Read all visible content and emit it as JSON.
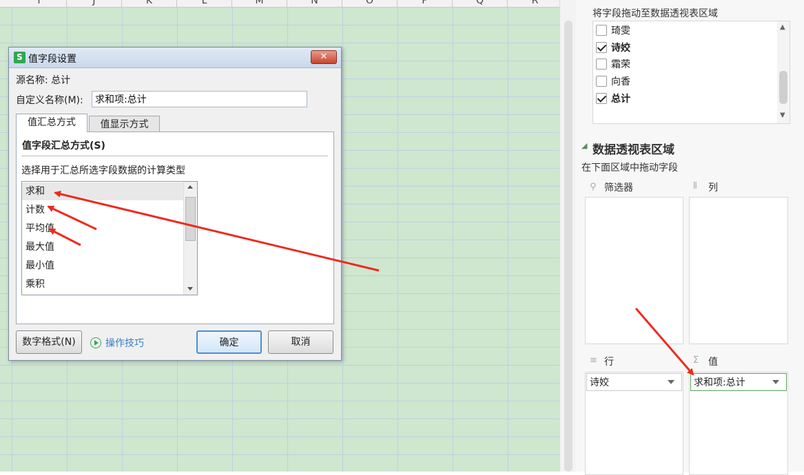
{
  "sheet": {
    "columns": [
      "I",
      "J",
      "K",
      "L",
      "M",
      "N",
      "O",
      "P",
      "Q",
      "R"
    ]
  },
  "dialog": {
    "title": "值字段设置",
    "app_icon": "S",
    "close_glyph": "✕",
    "source_label": "源名称: 总计",
    "custom_name_label": "自定义名称(M):",
    "custom_name_value": "求和项:总计",
    "tabs": [
      {
        "label": "值汇总方式"
      },
      {
        "label": "值显示方式"
      }
    ],
    "section_title": "值字段汇总方式(S)",
    "list_prompt": "选择用于汇总所选字段数据的计算类型",
    "functions": [
      "求和",
      "计数",
      "平均值",
      "最大值",
      "最小值",
      "乘积"
    ],
    "selected_function": "求和",
    "number_format_button": "数字格式(N)",
    "tips_link": "操作技巧",
    "ok_button": "确定",
    "cancel_button": "取消"
  },
  "panel": {
    "drag_hint": "将字段拖动至数据透视表区域",
    "fields": [
      {
        "label": "琦雯",
        "checked": false
      },
      {
        "label": "诗姣",
        "checked": true
      },
      {
        "label": "霜荣",
        "checked": false
      },
      {
        "label": "向香",
        "checked": false
      },
      {
        "label": "总计",
        "checked": true
      }
    ],
    "areas_title": "数据透视表区域",
    "areas_hint": "在下面区域中拖动字段",
    "filter_label": "筛选器",
    "columns_label": "列",
    "rows_label": "行",
    "values_label": "值",
    "rows_item": "诗姣",
    "values_item": "求和项:总计"
  },
  "colors": {
    "sheet_bg": "#cfe6cf",
    "arrow": "#ee2a1e",
    "link": "#3a7cc7",
    "ok_border": "#4a8fd4"
  }
}
